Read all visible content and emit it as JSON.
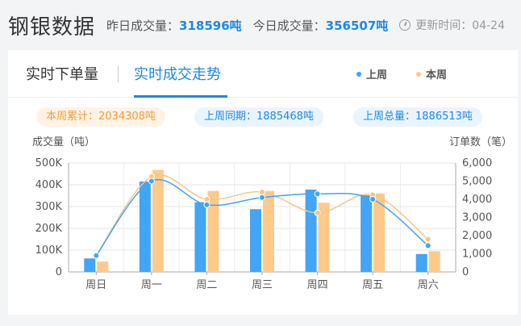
{
  "header": {
    "brand": "钢银数据",
    "yesterday_label": "昨日成交量：",
    "yesterday_value": "318596吨",
    "today_label": "今日成交量：",
    "today_value": "356507吨",
    "update_label": "更新时间：04-24"
  },
  "tabs": [
    {
      "label": "实时下单量"
    },
    {
      "label": "实时成交走势"
    }
  ],
  "legend": [
    {
      "label": "上周",
      "color": "#42a5f5"
    },
    {
      "label": "本周",
      "color": "#ffc98a"
    }
  ],
  "pills": [
    {
      "text": "本周累计：2034308吨"
    },
    {
      "text": "上周同期：1885468吨"
    },
    {
      "text": "上周总量：1886513吨"
    }
  ],
  "colors": {
    "accent": "#1e88e5",
    "last_week": "#42a5f5",
    "this_week": "#ffc98a",
    "this_week_line": "#f6c58a"
  },
  "chart_data": {
    "type": "bar",
    "ylabel_left": "成交量（吨）",
    "ylabel_right": "订单数（笔）",
    "categories": [
      "周日",
      "周一",
      "周二",
      "周三",
      "周四",
      "周五",
      "周六"
    ],
    "ylim_left": [
      0,
      500000
    ],
    "ylim_right": [
      0,
      6000
    ],
    "left_ticks": [
      "0",
      "100K",
      "200K",
      "300K",
      "400K",
      "500K"
    ],
    "right_ticks": [
      "0",
      "1,000",
      "2,000",
      "3,000",
      "4,000",
      "5,000",
      "6,000"
    ],
    "grid": true,
    "series": [
      {
        "name": "上周",
        "kind": "bar",
        "axis": "left",
        "values": [
          62000,
          415000,
          320000,
          288000,
          378000,
          352000,
          82000
        ]
      },
      {
        "name": "本周",
        "kind": "bar",
        "axis": "left",
        "values": [
          48000,
          468000,
          372000,
          372000,
          318000,
          360000,
          95000
        ]
      },
      {
        "name": "上周",
        "kind": "line",
        "axis": "right",
        "values": [
          900,
          5000,
          3700,
          4100,
          4300,
          4000,
          1450
        ]
      },
      {
        "name": "本周",
        "kind": "line",
        "axis": "right",
        "values": [
          900,
          5250,
          4000,
          4400,
          3250,
          4250,
          1800
        ]
      }
    ]
  }
}
